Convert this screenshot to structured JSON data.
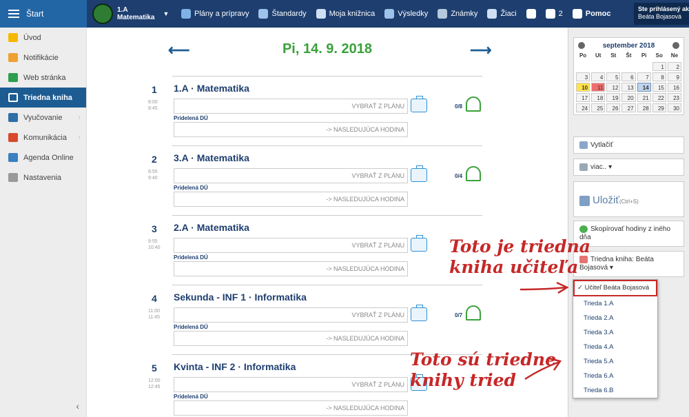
{
  "topbar": {
    "start_label": "Štart",
    "class_line1": "1.A",
    "class_line2": "Matematika",
    "menu": [
      {
        "label": "Plány a prípravy",
        "icon": "calendar-icon",
        "color": "#7fb3e6"
      },
      {
        "label": "Štandardy",
        "icon": "shield-icon",
        "color": "#9ec3ea"
      },
      {
        "label": "Moja knižnica",
        "icon": "library-icon",
        "color": "#cfe0f3"
      },
      {
        "label": "Výsledky",
        "icon": "bar-chart-icon",
        "color": "#9ec3ea"
      },
      {
        "label": "Známky",
        "icon": "grades-icon",
        "color": "#b6c9de"
      },
      {
        "label": "Žiaci",
        "icon": "students-icon",
        "color": "#cfe0f3"
      },
      {
        "label": "",
        "icon": "chat-icon",
        "color": "#ffffff"
      },
      {
        "label": "2",
        "icon": "mail-icon",
        "color": "#ffffff"
      },
      {
        "label": "Pomoc",
        "icon": "help-icon",
        "color": "#ffffff"
      }
    ],
    "user_line1": "Ste prihlásený ako",
    "user_line2": "Beáta Bojasová"
  },
  "sidebar": {
    "items": [
      {
        "label": "Úvod",
        "icon": "star-icon",
        "color": "#f5b800"
      },
      {
        "label": "Notifikácie",
        "icon": "envelope-icon",
        "color": "#f0a030"
      },
      {
        "label": "Web stránka",
        "icon": "home-icon",
        "color": "#2e9e4e"
      },
      {
        "label": "Triedna kniha",
        "icon": "book-icon",
        "color": "#ffffff"
      },
      {
        "label": "Vyučovanie",
        "icon": "open-book-icon",
        "color": "#2e6fa8"
      },
      {
        "label": "Komunikácia",
        "icon": "people-icon",
        "color": "#d9482b"
      },
      {
        "label": "Agenda Online",
        "icon": "pen-icon",
        "color": "#3a7fc0"
      },
      {
        "label": "Nastavenia",
        "icon": "gear-icon",
        "color": "#999999"
      }
    ]
  },
  "main": {
    "date": "Pi, 14. 9. 2018",
    "lessons": [
      {
        "num": "1",
        "title": "1.A · Matematika",
        "t1": "8:00",
        "t2": "8:45",
        "plan": "VYBRAŤ Z PLÁNU",
        "count": "0/8",
        "hw_label": "Pridelená DÚ",
        "hw": "-> NASLEDUJÚCA HODINA"
      },
      {
        "num": "2",
        "title": "3.A · Matematika",
        "t1": "8:55",
        "t2": "9:40",
        "plan": "VYBRAŤ Z PLÁNU",
        "count": "0/4",
        "hw_label": "Pridelená DÚ",
        "hw": "-> NASLEDUJÚCA HODINA"
      },
      {
        "num": "3",
        "title": "2.A · Matematika",
        "t1": "9:55",
        "t2": "10:40",
        "plan": "VYBRAŤ Z PLÁNU",
        "count": "",
        "hw_label": "Pridelená DÚ",
        "hw": "-> NASLEDUJÚCA HODINA"
      },
      {
        "num": "4",
        "title": "Sekunda - INF 1 · Informatika",
        "t1": "11:00",
        "t2": "11:45",
        "plan": "VYBRAŤ Z PLÁNU",
        "count": "0/7",
        "hw_label": "Pridelená DÚ",
        "hw": "-> NASLEDUJÚCA HODINA"
      },
      {
        "num": "5",
        "title": "Kvinta - INF 2 · Informatika",
        "t1": "12:00",
        "t2": "12:45",
        "plan": "VYBRAŤ Z PLÁNU",
        "count": "",
        "hw_label": "Pridelená DÚ",
        "hw": "-> NASLEDUJÚCA HODINA"
      }
    ]
  },
  "calendar": {
    "month": "september 2018",
    "dow": [
      "Po",
      "Ut",
      "St",
      "Št",
      "Pi",
      "So",
      "Ne"
    ],
    "weeks": [
      [
        "",
        "",
        "",
        "",
        "",
        "1",
        "2"
      ],
      [
        "3",
        "4",
        "5",
        "6",
        "7",
        "8",
        "9"
      ],
      [
        "10",
        "11",
        "12",
        "13",
        "14",
        "15",
        "16"
      ],
      [
        "17",
        "18",
        "19",
        "20",
        "21",
        "22",
        "23"
      ],
      [
        "24",
        "25",
        "26",
        "27",
        "28",
        "29",
        "30"
      ]
    ],
    "today": "10",
    "highlight": "11",
    "selected": "14"
  },
  "right": {
    "print": "Vytlačiť",
    "more": "viac.. ▾",
    "save": "Uložiť",
    "save_hint": "(Ctrl+S)",
    "copy": "Skopírovať hodiny z iného dňa",
    "book_select": "Triedna kniha: Beáta Bojasová ▾",
    "dropdown_selected": "✓ Učiteľ Beáta Bojasová",
    "dropdown_items": [
      "Trieda 1.A",
      "Trieda 2.A",
      "Trieda 3.A",
      "Trieda 4.A",
      "Trieda 5.A",
      "Trieda 6.A",
      "Trieda 6.B"
    ]
  },
  "annotations": {
    "note1_line1": "Toto je triedna",
    "note1_line2": "kniha učiteľa",
    "note2_line1": "Toto sú triedne",
    "note2_line2": "knihy tried"
  }
}
